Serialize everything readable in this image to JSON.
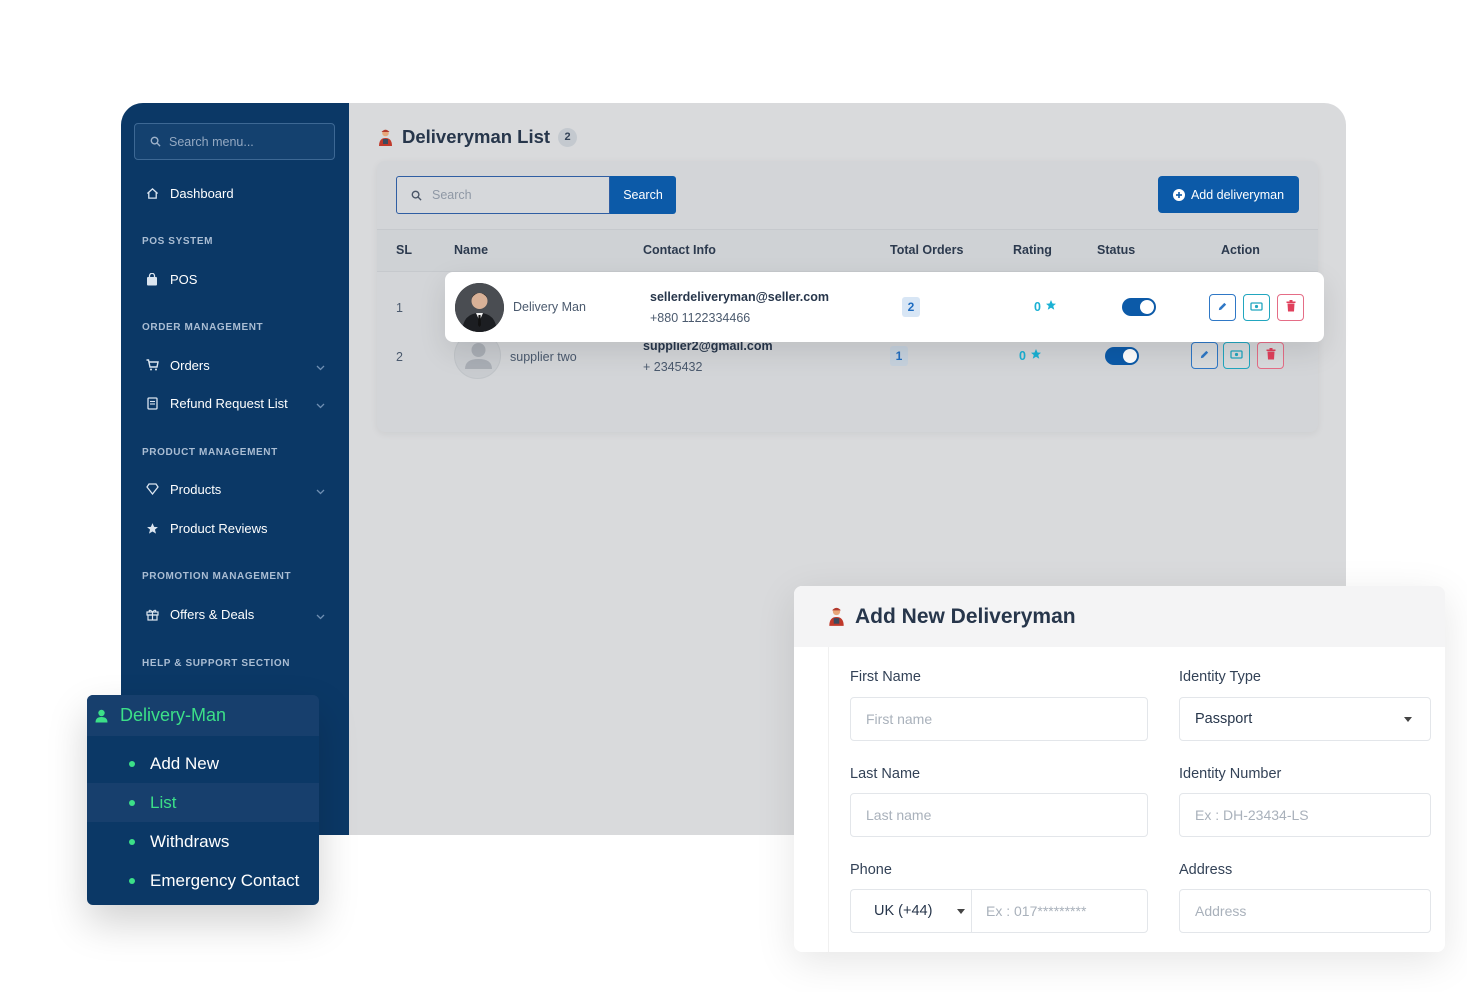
{
  "sidebar": {
    "search_placeholder": "Search menu...",
    "dashboard": "Dashboard",
    "sections": {
      "pos": "POS SYSTEM",
      "orders": "ORDER MANAGEMENT",
      "products": "PRODUCT MANAGEMENT",
      "promotion": "PROMOTION MANAGEMENT",
      "help": "HELP & SUPPORT SECTION"
    },
    "items": {
      "pos": "POS",
      "orders": "Orders",
      "refund": "Refund Request List",
      "products": "Products",
      "reviews": "Product Reviews",
      "offers": "Offers & Deals"
    }
  },
  "page": {
    "title": "Deliveryman List",
    "count": "2",
    "search_placeholder": "Search",
    "search_button": "Search",
    "add_button": "Add deliveryman"
  },
  "table": {
    "headers": [
      "SL",
      "Name",
      "Contact Info",
      "Total Orders",
      "Rating",
      "Status",
      "Action"
    ],
    "rows": [
      {
        "sl": "1",
        "name": "Delivery Man",
        "email": "sellerdeliveryman@seller.com",
        "phone": "+880 1122334466",
        "orders": "2",
        "rating": "0",
        "status": "active"
      },
      {
        "sl": "2",
        "name": "supplier two",
        "email": "supplier2@gmail.com",
        "phone": "+ 2345432",
        "orders": "1",
        "rating": "0",
        "status": "active"
      }
    ]
  },
  "delivery_menu": {
    "title": "Delivery-Man",
    "items": [
      "Add New",
      "List",
      "Withdraws",
      "Emergency Contact"
    ],
    "active": "List"
  },
  "form": {
    "title": "Add New Deliveryman",
    "first_name_label": "First Name",
    "first_name_placeholder": "First name",
    "last_name_label": "Last Name",
    "last_name_placeholder": "Last name",
    "phone_label": "Phone",
    "phone_code": "UK (+44)",
    "phone_placeholder": "Ex : 017*********",
    "identity_type_label": "Identity Type",
    "identity_type_value": "Passport",
    "identity_number_label": "Identity Number",
    "identity_number_placeholder": "Ex : DH-23434-LS",
    "address_label": "Address",
    "address_placeholder": "Address"
  },
  "colors": {
    "sidebar": "#0b3866",
    "primary": "#0c5aa8",
    "accent_green": "#3ce088",
    "rating": "#1ab1d4",
    "delete": "#e0405c"
  }
}
